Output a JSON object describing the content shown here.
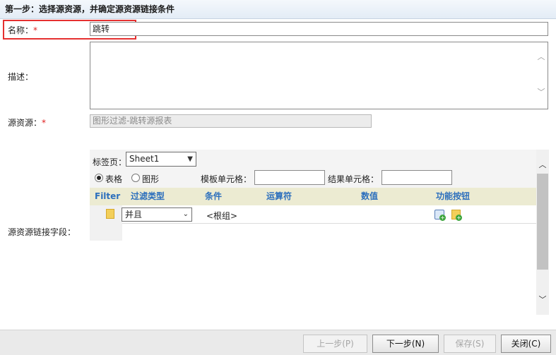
{
  "header": {
    "title": "第一步：选择源资源，并确定源资源链接条件"
  },
  "form": {
    "name_label": "名称：",
    "required_mark": "*",
    "name_value": "跳转",
    "desc_label": "描述：",
    "source_label": "源资源：",
    "source_value": "图形过滤-跳转源报表",
    "link_fields_label": "源资源链接字段："
  },
  "panel": {
    "sheet_label": "标签页：",
    "sheet_value": "Sheet1",
    "radio_table": "表格",
    "radio_chart": "图形",
    "radio_selected": "表格",
    "template_cell_label": "模板单元格：",
    "template_cell_value": "",
    "result_cell_label": "结果单元格：",
    "result_cell_value": ""
  },
  "grid": {
    "columns": [
      "Filter",
      "过滤类型",
      "条件",
      "运算符",
      "数值",
      "功能按钮"
    ],
    "rows": [
      {
        "filter_type": "并且",
        "condition": "<根组>"
      }
    ]
  },
  "buttons": {
    "prev": "上一步(P)",
    "next": "下一步(N)",
    "save": "保存(S)",
    "close": "关闭(C)"
  },
  "icons": [
    "folder-icon",
    "add-condition-icon",
    "add-group-icon",
    "chevron-down-icon",
    "scroll-up-icon",
    "scroll-down-icon"
  ],
  "colors": {
    "required": "#e02020",
    "highlight": "#e53030",
    "grid_header_text": "#2c6fbd",
    "grid_header_bg": "#ecebd2"
  }
}
